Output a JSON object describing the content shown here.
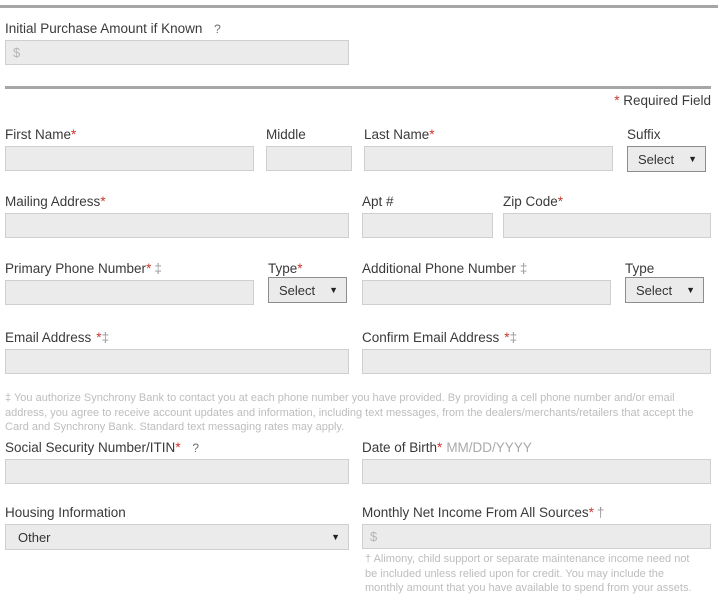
{
  "dividers": {
    "present": true
  },
  "initial_purchase": {
    "label": "Initial Purchase Amount if Known",
    "help_icon": "question-mark-icon",
    "help": "?",
    "value": "",
    "placeholder": "$"
  },
  "required_note": {
    "asterisk": "*",
    "text": " Required Field"
  },
  "name_row": {
    "first_name": {
      "label": "First Name",
      "required": "*",
      "value": "",
      "placeholder": ""
    },
    "middle": {
      "label": "Middle",
      "value": "",
      "placeholder": ""
    },
    "last_name": {
      "label": "Last Name",
      "required": "*",
      "value": "",
      "placeholder": ""
    },
    "suffix": {
      "label": "Suffix",
      "selected": "Select",
      "caret": "▼"
    }
  },
  "address_row": {
    "mailing_address": {
      "label": "Mailing Address",
      "required": "*",
      "value": "",
      "placeholder": ""
    },
    "apt": {
      "label": "Apt #",
      "value": "",
      "placeholder": ""
    },
    "zip_code": {
      "label": "Zip Code",
      "required": "*",
      "value": "",
      "placeholder": ""
    }
  },
  "phone_row": {
    "primary_phone": {
      "label": "Primary Phone Number",
      "required": "*",
      "dagger": "‡",
      "value": "",
      "placeholder": ""
    },
    "primary_type": {
      "label": "Type",
      "required": "*",
      "selected": "Select",
      "caret": "▼"
    },
    "additional_phone": {
      "label": "Additional Phone Number",
      "dagger": "‡",
      "value": "",
      "placeholder": ""
    },
    "additional_type": {
      "label": "Type",
      "selected": "Select",
      "caret": "▼"
    }
  },
  "email_row": {
    "email": {
      "label": "Email Address",
      "required": "*",
      "dagger": "‡",
      "value": "",
      "placeholder": ""
    },
    "confirm_email": {
      "label": "Confirm Email Address",
      "required": "*",
      "dagger": "‡",
      "value": "",
      "placeholder": ""
    }
  },
  "phone_disclosure": "‡ You authorize Synchrony Bank to contact you at each phone number you have provided. By providing a cell phone number and/or email address, you agree to receive account updates and information, including text messages, from the dealers/merchants/retailers that accept the Card and Synchrony Bank. Standard text messaging rates may apply.",
  "identity_row": {
    "ssn": {
      "label": "Social Security Number/ITIN",
      "required": "*",
      "help": "?",
      "value": "",
      "placeholder": ""
    },
    "dob": {
      "label": "Date of Birth",
      "required": "*",
      "format_hint": "MM/DD/YYYY",
      "value": "",
      "placeholder": ""
    }
  },
  "bottom_row": {
    "housing": {
      "label": "Housing Information",
      "selected": "Other",
      "caret": "▼"
    },
    "income": {
      "label": "Monthly Net Income From All Sources",
      "required": "*",
      "dagger": "†",
      "value": "",
      "placeholder": "$"
    }
  },
  "income_disclosure": "† Alimony, child support or separate maintenance income need not be included unless relied upon for credit. You may include the monthly amount that you have available to spend from your assets.",
  "colors": {
    "required_red": "#d0342c",
    "field_background": "#ebebeb",
    "field_border": "#cfcfcf",
    "select_border": "#8d8d8d",
    "divider": "#a6a6a6",
    "footnote_text": "#bdbdbd",
    "label_text": "#3a3a3a"
  }
}
